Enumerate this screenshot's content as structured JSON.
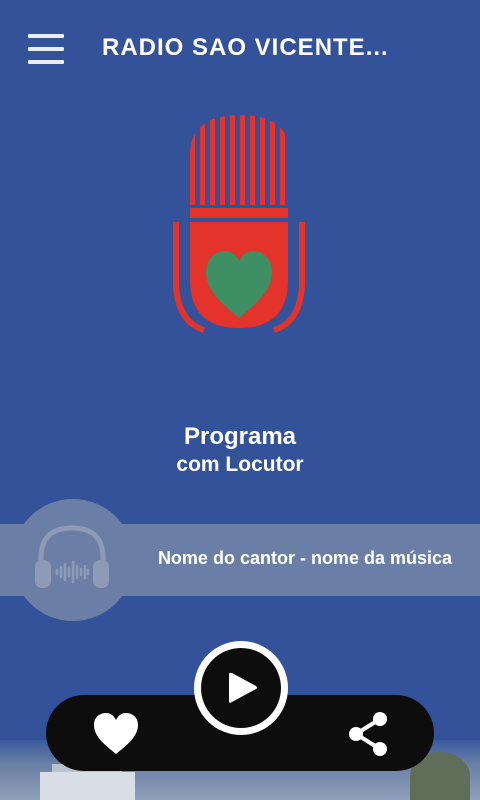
{
  "header": {
    "title": "RADIO SAO VICENTE..."
  },
  "program": {
    "name": "Programa",
    "host": "com Locutor"
  },
  "now_playing": {
    "text": "Nome do cantor - nome da música"
  },
  "colors": {
    "background": "#34529a",
    "accent_red": "#e3332a",
    "accent_green": "#3e8f63",
    "strip": "#6b7fa6",
    "controls": "#0d0d0d"
  },
  "icons": [
    "menu-icon",
    "microphone-logo",
    "headphones-icon",
    "play-icon",
    "heart-icon",
    "share-icon"
  ]
}
